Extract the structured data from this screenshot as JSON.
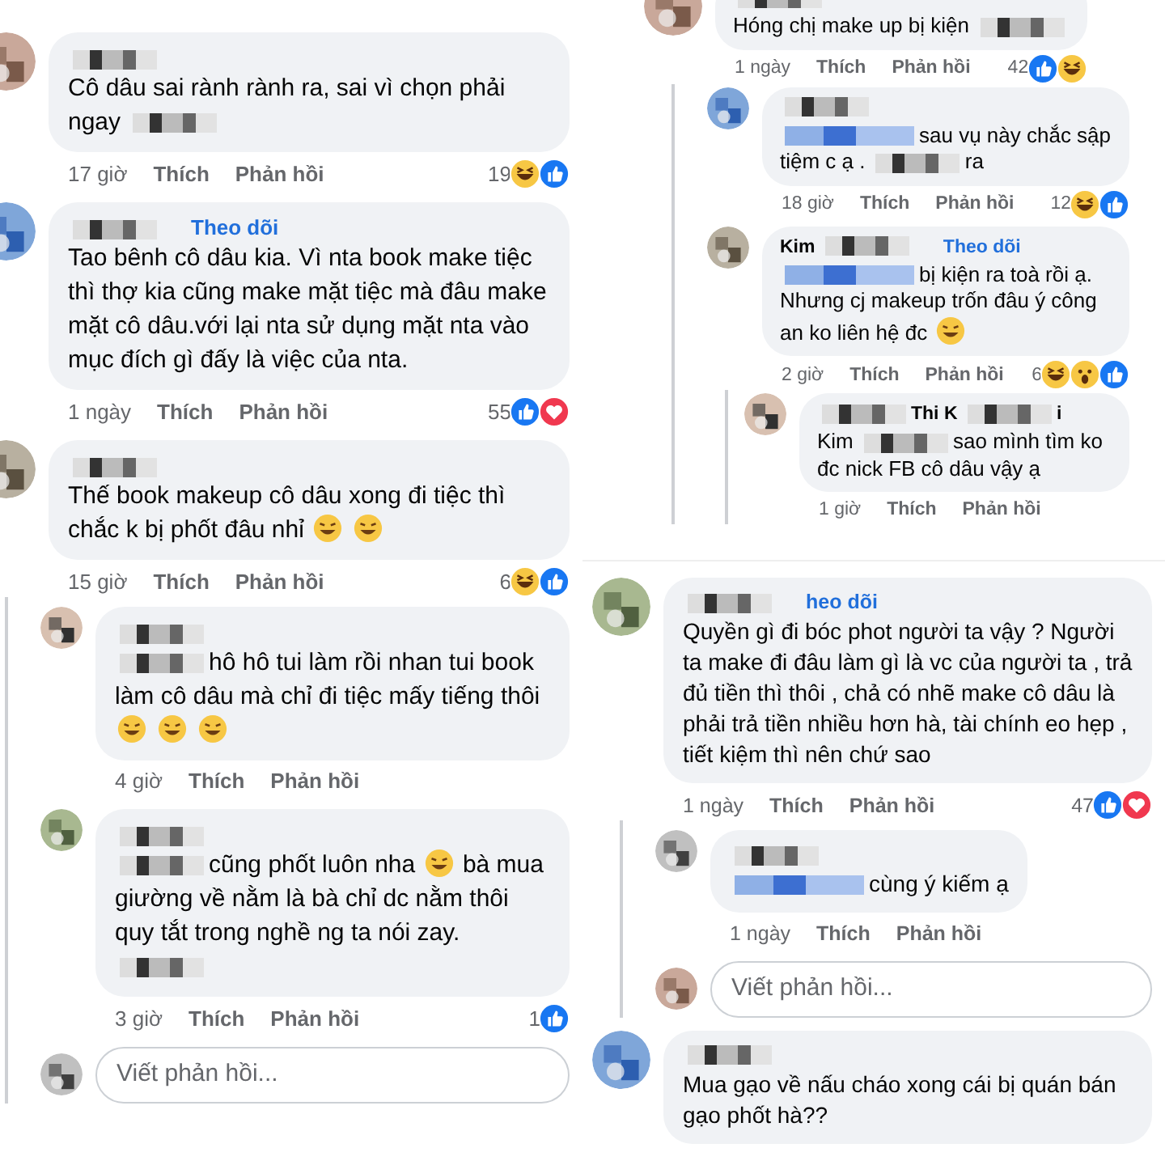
{
  "columns": [
    {
      "panels": [
        {
          "items": [
            {
              "kind": "comment",
              "name": [
                {
                  "kind": "redacted"
                }
              ],
              "text": [
                {
                  "kind": "text",
                  "text": "Cô dâu sai rành rành ra, sai vì chọn phải ngay"
                },
                {
                  "kind": "redacted"
                }
              ],
              "time": "17 giờ",
              "like": "Thích",
              "reply": "Phản hồi",
              "count": "19",
              "reactions": [
                {
                  "kind": "haha"
                },
                {
                  "kind": "like"
                }
              ]
            },
            {
              "kind": "comment",
              "name": [
                {
                  "kind": "redacted"
                }
              ],
              "follow": "Theo dõi",
              "text": [
                {
                  "kind": "text",
                  "text": "Tao bênh cô dâu kia. Vì nta book make tiệc thì thợ kia cũng make mặt tiệc mà đâu make mặt cô dâu.với lại nta sử dụng mặt nta vào mục đích gì đấy là việc của nta."
                }
              ],
              "time": "1 ngày",
              "like": "Thích",
              "reply": "Phản hồi",
              "count": "55",
              "reactions": [
                {
                  "kind": "like"
                },
                {
                  "kind": "love"
                }
              ]
            },
            {
              "kind": "comment",
              "name": [
                {
                  "kind": "redacted"
                }
              ],
              "text": [
                {
                  "kind": "text",
                  "text": "Thế book makeup cô dâu xong đi tiệc thì chắc k bị phốt đâu nhỉ"
                },
                {
                  "kind": "emoji"
                },
                {
                  "kind": "emoji"
                }
              ],
              "time": "15 giờ",
              "like": "Thích",
              "reply": "Phản hồi",
              "count": "6",
              "reactions": [
                {
                  "kind": "haha"
                },
                {
                  "kind": "like"
                }
              ],
              "children": [
                {
                  "kind": "comment",
                  "name": [
                    {
                      "kind": "redacted"
                    }
                  ],
                  "text": [
                    {
                      "kind": "redacted"
                    },
                    {
                      "kind": "text",
                      "text": "hô hô tui làm rồi nhan tui book làm cô dâu mà chỉ đi tiệc mấy tiếng thôi"
                    },
                    {
                      "kind": "emoji"
                    },
                    {
                      "kind": "emoji"
                    },
                    {
                      "kind": "emoji"
                    }
                  ],
                  "time": "4 giờ",
                  "like": "Thích",
                  "reply": "Phản hồi"
                },
                {
                  "kind": "comment",
                  "name": [
                    {
                      "kind": "redacted"
                    }
                  ],
                  "text": [
                    {
                      "kind": "redacted"
                    },
                    {
                      "kind": "text",
                      "text": "cũng phốt luôn nha"
                    },
                    {
                      "kind": "emoji"
                    },
                    {
                      "kind": "text",
                      "text": "bà mua giường về nằm là bà chỉ dc nằm thôi quy tắt trong nghề ng ta nói zay."
                    },
                    {
                      "kind": "redacted"
                    }
                  ],
                  "time": "3 giờ",
                  "like": "Thích",
                  "reply": "Phản hồi",
                  "count": "1",
                  "reactions": [
                    {
                      "kind": "like"
                    }
                  ]
                },
                {
                  "kind": "reply_box",
                  "placeholder": "Viết phản hồi..."
                }
              ]
            }
          ]
        }
      ]
    },
    {
      "panels": [
        {
          "items": [
            {
              "kind": "comment",
              "name": [
                {
                  "kind": "redacted"
                }
              ],
              "text": [
                {
                  "kind": "text",
                  "text": "Hóng chị make up bị kiện"
                },
                {
                  "kind": "redacted"
                }
              ],
              "time": "1 ngày",
              "like": "Thích",
              "reply": "Phản hồi",
              "count": "42",
              "reactions": [
                {
                  "kind": "like"
                },
                {
                  "kind": "haha"
                }
              ],
              "children": [
                {
                  "kind": "comment",
                  "name": [
                    {
                      "kind": "redacted"
                    }
                  ],
                  "text": [
                    {
                      "kind": "redacted_mention"
                    },
                    {
                      "kind": "text",
                      "text": "sau vụ này chắc sập tiệm c ạ ."
                    },
                    {
                      "kind": "redacted"
                    },
                    {
                      "kind": "text",
                      "text": "ra"
                    }
                  ],
                  "time": "18 giờ",
                  "like": "Thích",
                  "reply": "Phản hồi",
                  "count": "12",
                  "reactions": [
                    {
                      "kind": "haha"
                    },
                    {
                      "kind": "like"
                    }
                  ]
                },
                {
                  "kind": "comment",
                  "name": [
                    {
                      "kind": "text",
                      "text": "Kim"
                    },
                    {
                      "kind": "redacted"
                    }
                  ],
                  "follow": "Theo dõi",
                  "text": [
                    {
                      "kind": "redacted_mention"
                    },
                    {
                      "kind": "text",
                      "text": "bị kiện ra toà rồi ạ. Nhưng cj makeup trốn đâu ý công an ko liên hệ đc"
                    },
                    {
                      "kind": "emoji"
                    }
                  ],
                  "time": "2 giờ",
                  "like": "Thích",
                  "reply": "Phản hồi",
                  "count": "6",
                  "reactions": [
                    {
                      "kind": "haha"
                    },
                    {
                      "kind": "wow"
                    },
                    {
                      "kind": "like"
                    }
                  ],
                  "children": [
                    {
                      "kind": "comment",
                      "name": [
                        {
                          "kind": "redacted"
                        },
                        {
                          "kind": "text",
                          "text": "Thi K"
                        },
                        {
                          "kind": "redacted"
                        },
                        {
                          "kind": "text",
                          "text": "i"
                        }
                      ],
                      "text": [
                        {
                          "kind": "text",
                          "text": "Kim"
                        },
                        {
                          "kind": "redacted"
                        },
                        {
                          "kind": "text",
                          "text": "sao mình tìm ko đc nick FB cô dâu vậy ạ"
                        }
                      ],
                      "time": "1 giờ",
                      "like": "Thích",
                      "reply": "Phản hồi"
                    }
                  ]
                }
              ]
            }
          ]
        },
        {
          "items": [
            {
              "kind": "comment",
              "name": [
                {
                  "kind": "redacted"
                }
              ],
              "follow": "heo dõi",
              "text": [
                {
                  "kind": "text",
                  "text": "Quyền gì đi bóc phot người ta vậy ? Người ta make đi đâu làm gì là vc của người ta , trả đủ tiền thì thôi , chả có nhẽ make cô dâu là phải trả tiền nhiều hơn hà, tài chính eo hẹp , tiết kiệm thì nên chứ sao"
                }
              ],
              "time": "1 ngày",
              "like": "Thích",
              "reply": "Phản hồi",
              "count": "47",
              "reactions": [
                {
                  "kind": "like"
                },
                {
                  "kind": "love"
                }
              ],
              "children": [
                {
                  "kind": "comment",
                  "name": [
                    {
                      "kind": "redacted"
                    }
                  ],
                  "text": [
                    {
                      "kind": "redacted_mention"
                    },
                    {
                      "kind": "text",
                      "text": "cùng ý kiếm ạ"
                    }
                  ],
                  "time": "1 ngày",
                  "like": "Thích",
                  "reply": "Phản hồi"
                },
                {
                  "kind": "reply_box",
                  "placeholder": "Viết phản hồi..."
                }
              ]
            },
            {
              "kind": "comment",
              "name": [
                {
                  "kind": "redacted"
                }
              ],
              "text": [
                {
                  "kind": "text",
                  "text": "Mua gạo về nấu cháo xong cái bị quán bán gạo phốt hà??"
                }
              ]
            }
          ]
        }
      ]
    }
  ]
}
